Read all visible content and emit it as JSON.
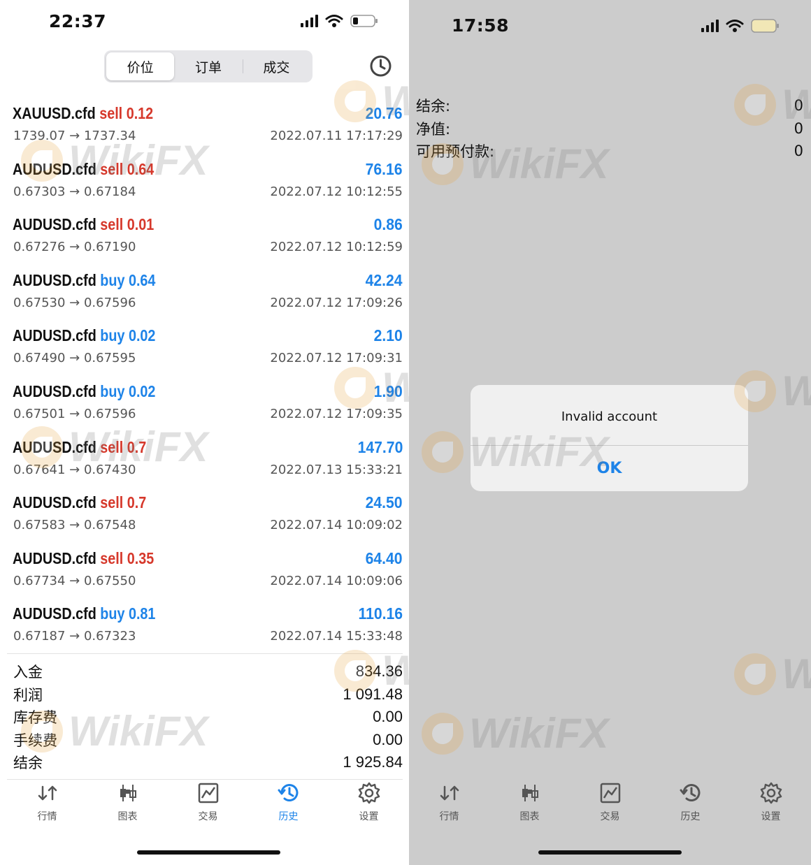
{
  "left": {
    "status": {
      "time": "22:37"
    },
    "segments": [
      "价位",
      "订单",
      "成交"
    ],
    "active_segment": 0,
    "trades": [
      {
        "symbol": "XAUUSD.cfd",
        "side": "sell",
        "volume": "0.12",
        "prices": "1739.07 → 1737.34",
        "profit": "20.76",
        "time": "2022.07.11 17:17:29"
      },
      {
        "symbol": "AUDUSD.cfd",
        "side": "sell",
        "volume": "0.64",
        "prices": "0.67303 → 0.67184",
        "profit": "76.16",
        "time": "2022.07.12 10:12:55"
      },
      {
        "symbol": "AUDUSD.cfd",
        "side": "sell",
        "volume": "0.01",
        "prices": "0.67276 → 0.67190",
        "profit": "0.86",
        "time": "2022.07.12 10:12:59"
      },
      {
        "symbol": "AUDUSD.cfd",
        "side": "buy",
        "volume": "0.64",
        "prices": "0.67530 → 0.67596",
        "profit": "42.24",
        "time": "2022.07.12 17:09:26"
      },
      {
        "symbol": "AUDUSD.cfd",
        "side": "buy",
        "volume": "0.02",
        "prices": "0.67490 → 0.67595",
        "profit": "2.10",
        "time": "2022.07.12 17:09:31"
      },
      {
        "symbol": "AUDUSD.cfd",
        "side": "buy",
        "volume": "0.02",
        "prices": "0.67501 → 0.67596",
        "profit": "1.90",
        "time": "2022.07.12 17:09:35"
      },
      {
        "symbol": "AUDUSD.cfd",
        "side": "sell",
        "volume": "0.7",
        "prices": "0.67641 → 0.67430",
        "profit": "147.70",
        "time": "2022.07.13 15:33:21"
      },
      {
        "symbol": "AUDUSD.cfd",
        "side": "sell",
        "volume": "0.7",
        "prices": "0.67583 → 0.67548",
        "profit": "24.50",
        "time": "2022.07.14 10:09:02"
      },
      {
        "symbol": "AUDUSD.cfd",
        "side": "sell",
        "volume": "0.35",
        "prices": "0.67734 → 0.67550",
        "profit": "64.40",
        "time": "2022.07.14 10:09:06"
      },
      {
        "symbol": "AUDUSD.cfd",
        "side": "buy",
        "volume": "0.81",
        "prices": "0.67187 → 0.67323",
        "profit": "110.16",
        "time": "2022.07.14 15:33:48"
      }
    ],
    "summary": [
      {
        "label": "入金",
        "value": "834.36"
      },
      {
        "label": "利润",
        "value": "1 091.48"
      },
      {
        "label": "库存费",
        "value": "0.00"
      },
      {
        "label": "手续费",
        "value": "0.00"
      },
      {
        "label": "结余",
        "value": "1 925.84"
      }
    ],
    "tabs": [
      "行情",
      "图表",
      "交易",
      "历史",
      "设置"
    ],
    "active_tab": 3
  },
  "right": {
    "status": {
      "time": "17:58"
    },
    "account": [
      {
        "label": "结余:",
        "value": "0"
      },
      {
        "label": "净值:",
        "value": "0"
      },
      {
        "label": "可用预付款:",
        "value": "0"
      }
    ],
    "alert": {
      "message": "Invalid account",
      "button": "OK"
    },
    "tabs": [
      "行情",
      "图表",
      "交易",
      "历史",
      "设置"
    ]
  },
  "watermark": "WikiFX",
  "colors": {
    "sell": "#d6382b",
    "buy": "#1d83e8",
    "accent": "#1d83e8",
    "dim_background": "#cccccc"
  }
}
